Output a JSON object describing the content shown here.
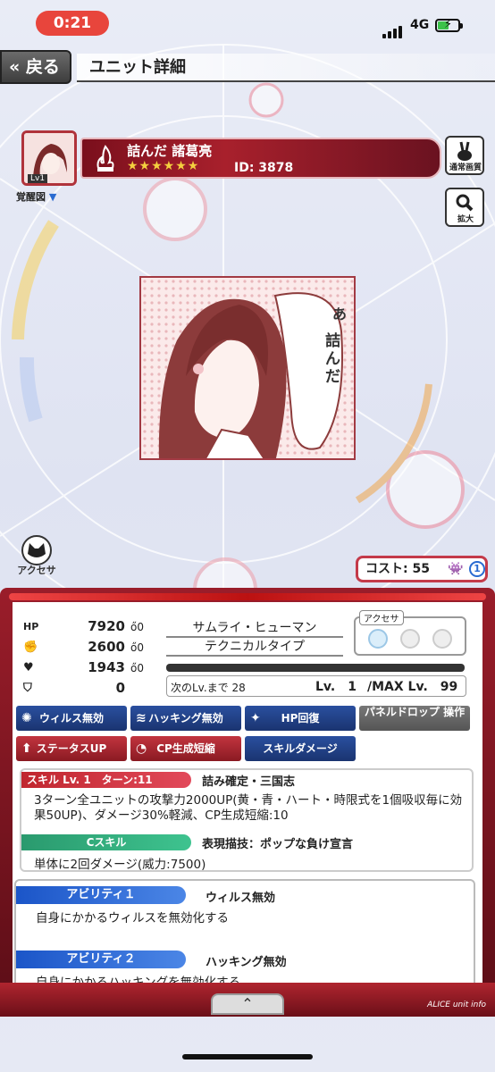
{
  "status": {
    "time": "0:21",
    "network": "4G"
  },
  "nav": {
    "back_label": "戻る",
    "title": "ユニット詳細"
  },
  "unit": {
    "level_badge": "Lv1",
    "awakening_label": "覚醒図",
    "name": "詰んだ 諸葛亮",
    "stars": "★★★★★★",
    "id_text": "ID: 3878"
  },
  "side_buttons": {
    "normal_label": "通常画質",
    "zoom_label": "拡大"
  },
  "manga": {
    "bubble_line1": "あ",
    "bubble_line2": "詰んだ"
  },
  "accessory_button_label": "アクセサ",
  "cost": {
    "text": "コスト: 55",
    "badge": "1"
  },
  "stats": [
    {
      "icon": "hp-icon",
      "label": "HP",
      "value": "7920",
      "sub": "0"
    },
    {
      "icon": "attack-fist-icon",
      "label": "",
      "value": "2600",
      "sub": "0"
    },
    {
      "icon": "heart-icon",
      "label": "",
      "value": "1943",
      "sub": "0"
    },
    {
      "icon": "shield-icon",
      "label": "",
      "value": "0",
      "sub": ""
    }
  ],
  "race": {
    "line1": "サムライ・ヒューマン",
    "line2": "テクニカルタイプ"
  },
  "accessory_box_label": "アクセサ",
  "level": {
    "next": "次のLv.まで 28",
    "lv_text": "Lv.　1",
    "max_text": "/MAX Lv.　99",
    "exp_fraction": 0.0
  },
  "tags": [
    {
      "label": "ウィルス無効",
      "color": "blue"
    },
    {
      "label": "ハッキング無効",
      "color": "blue"
    },
    {
      "label": "HP回復",
      "color": "blue"
    },
    {
      "label": "パネルドロップ 操作",
      "color": "gray"
    },
    {
      "label": "ステータスUP",
      "color": "red"
    },
    {
      "label": "CP生成短縮",
      "color": "red"
    },
    {
      "label": "スキルダメージ",
      "color": "blue"
    }
  ],
  "skill": {
    "head": "スキル Lv.  1　ターン:11",
    "name": "詰み確定・三国志",
    "desc": "3ターン全ユニットの攻撃力2000UP(黄・青・ハート・時限式を1個吸収毎に効果50UP)、ダメージ30%軽減、CP生成短縮:10"
  },
  "cskill": {
    "head": "Cスキル",
    "name": "表現描技：ポップな負け宣言",
    "desc": "単体に2回ダメージ(威力:7500)"
  },
  "abilities": [
    {
      "head": "アビリティ１",
      "name": "ウィルス無効",
      "desc": "自身にかかるウィルスを無効化する"
    },
    {
      "head": "アビリティ２",
      "name": "ハッキング無効",
      "desc": "自身にかかるハッキングを無効化する"
    }
  ],
  "footer_brand": "ALICE unit info"
}
